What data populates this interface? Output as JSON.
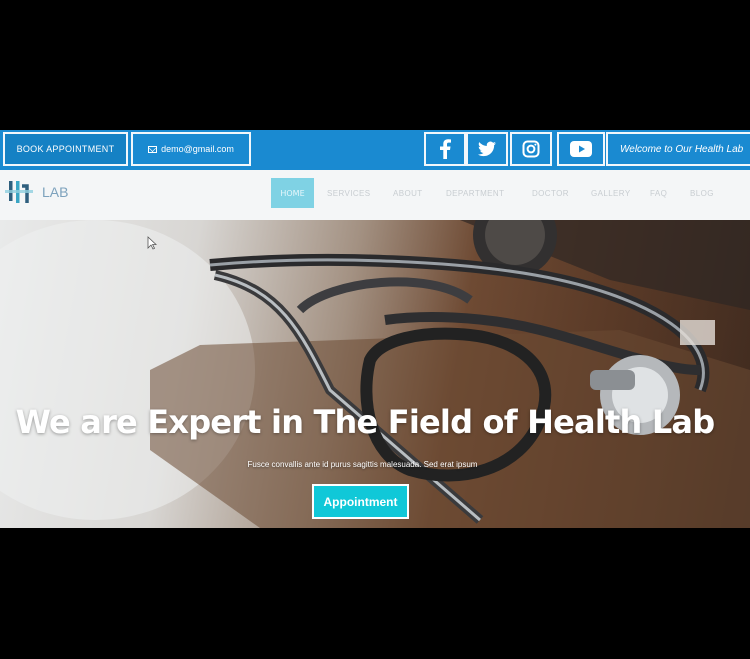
{
  "topbar": {
    "book_label": "BOOK APPOINTMENT",
    "email": "demo@gmail.com",
    "social": [
      "facebook-icon",
      "twitter-icon",
      "instagram-icon",
      "youtube-icon"
    ],
    "welcome": "Welcome to Our Health Lab"
  },
  "logo": {
    "prefix": "",
    "suffix": "LAB"
  },
  "nav": {
    "home": "HOME",
    "items": [
      "SERVICES",
      "ABOUT",
      "DEPARTMENT",
      "DOCTOR",
      "GALLERY",
      "FAQ",
      "BLOG"
    ]
  },
  "hero": {
    "title": "We are Expert in The Field of Health Lab",
    "subtitle": "Fusce convallis ante id purus sagittis malesuada. Sed erat ipsum",
    "button": "Appointment"
  },
  "colors": {
    "primary_blue": "#1a8ad1",
    "accent_cyan": "#10c8d8"
  }
}
